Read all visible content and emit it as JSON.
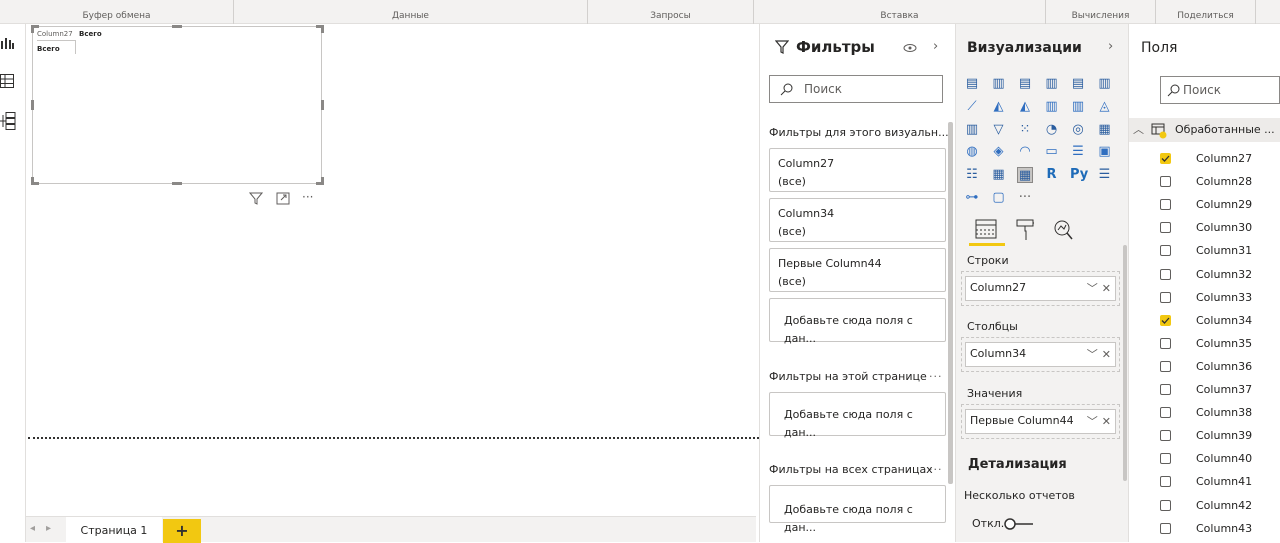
{
  "ribbon": {
    "groups": [
      {
        "label": "Буфер обмена"
      },
      {
        "label": "Данные"
      },
      {
        "label": "Запросы"
      },
      {
        "label": "Вставка"
      },
      {
        "label": "Вычисления"
      },
      {
        "label": "Поделиться"
      }
    ]
  },
  "visual": {
    "header_col": "Column27",
    "header_total": "Всего",
    "row_total": "Всего"
  },
  "tabs": {
    "page": "Страница 1",
    "add": "+"
  },
  "filters": {
    "title": "Фильтры",
    "search_placeholder": "Поиск",
    "section_visual": "Фильтры для этого визуальн...",
    "section_page": "Фильтры на этой странице",
    "section_all": "Фильтры на всех страницах",
    "more": "···",
    "cards": [
      {
        "name": "Column27",
        "value": "(все)"
      },
      {
        "name": "Column34",
        "value": "(все)"
      },
      {
        "name": "Первые Column44",
        "value": "(все)"
      }
    ],
    "add_here": "Добавьте сюда поля с дан..."
  },
  "viz": {
    "title": "Визуализации",
    "wells": [
      {
        "label": "Строки",
        "field": "Column27"
      },
      {
        "label": "Столбцы",
        "field": "Column34"
      },
      {
        "label": "Значения",
        "field": "Первые Column44"
      }
    ],
    "drill_title": "Детализация",
    "multi_reports": "Несколько отчетов",
    "toggle_off": "Откл."
  },
  "fields": {
    "title": "Поля",
    "search_placeholder": "Поиск",
    "table_name": "Обработанные ...",
    "items": [
      {
        "name": "Column27",
        "checked": true
      },
      {
        "name": "Column28",
        "checked": false
      },
      {
        "name": "Column29",
        "checked": false
      },
      {
        "name": "Column30",
        "checked": false
      },
      {
        "name": "Column31",
        "checked": false
      },
      {
        "name": "Column32",
        "checked": false
      },
      {
        "name": "Column33",
        "checked": false
      },
      {
        "name": "Column34",
        "checked": true
      },
      {
        "name": "Column35",
        "checked": false
      },
      {
        "name": "Column36",
        "checked": false
      },
      {
        "name": "Column37",
        "checked": false
      },
      {
        "name": "Column38",
        "checked": false
      },
      {
        "name": "Column39",
        "checked": false
      },
      {
        "name": "Column40",
        "checked": false
      },
      {
        "name": "Column41",
        "checked": false
      },
      {
        "name": "Column42",
        "checked": false
      },
      {
        "name": "Column43",
        "checked": false
      }
    ]
  },
  "colors": {
    "accent": "#f2c811",
    "panel": "#f3f2f1",
    "border": "#c8c6c4"
  }
}
